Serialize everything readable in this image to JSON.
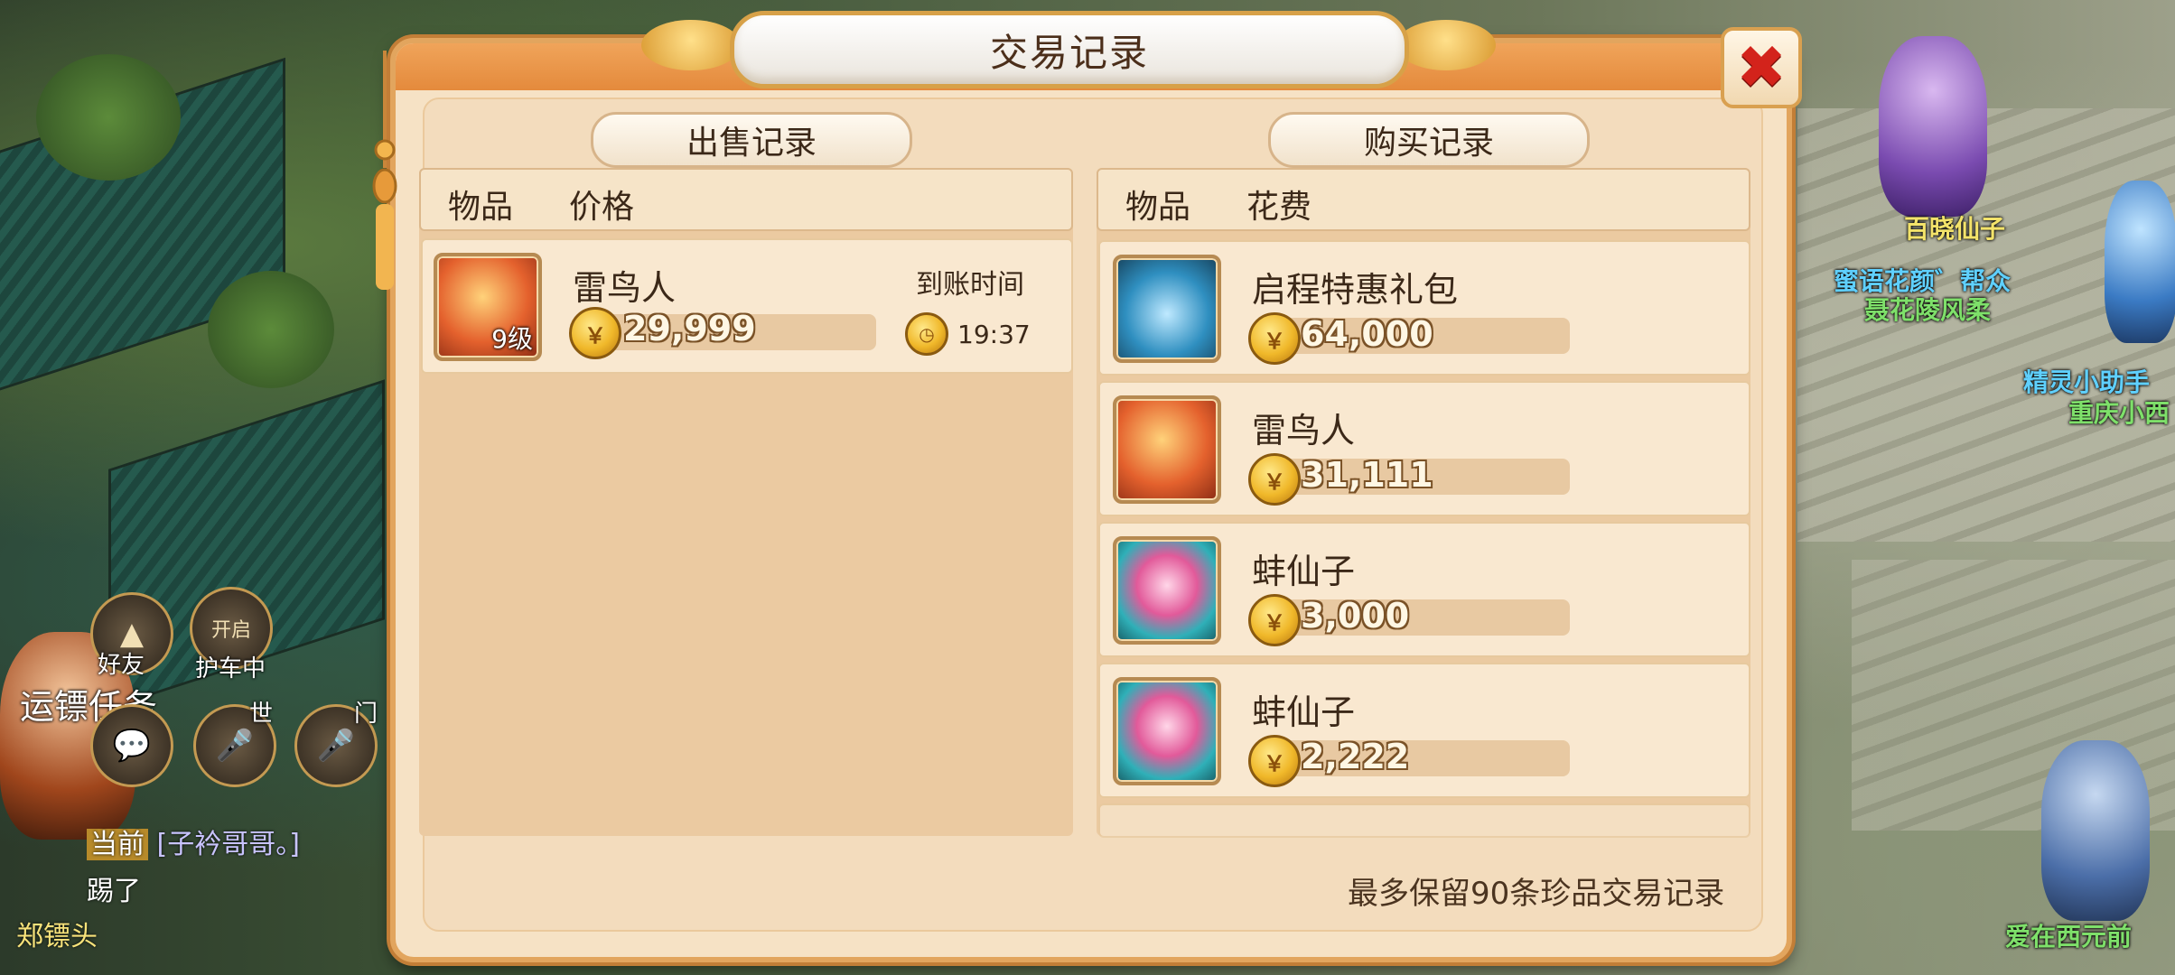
{
  "dialog": {
    "title": "交易记录",
    "close_symbol": "✖",
    "footer_note": "最多保留90条珍品交易记录"
  },
  "sell": {
    "tab_label": "出售记录",
    "col_item": "物品",
    "col_price": "价格",
    "arrival_label": "到账时间",
    "records": [
      {
        "name": "雷鸟人",
        "level": "9级",
        "price": "29,999",
        "time": "19:37",
        "icon": "thunderbird-icon"
      }
    ]
  },
  "buy": {
    "tab_label": "购买记录",
    "col_item": "物品",
    "col_cost": "花费",
    "records": [
      {
        "name": "启程特惠礼包",
        "price": "64,000",
        "icon": "treasure-chest-icon"
      },
      {
        "name": "雷鸟人",
        "price": "31,111",
        "icon": "thunderbird-icon"
      },
      {
        "name": "蚌仙子",
        "price": "3,000",
        "icon": "clam-fairy-icon"
      },
      {
        "name": "蚌仙子",
        "price": "2,222",
        "icon": "clam-fairy-icon"
      }
    ]
  },
  "hud": {
    "friend_label": "好友",
    "escort_label": "护车中",
    "escort_badge": "开启",
    "quest_label": "运镖任务",
    "world_tag": "世",
    "team_tag": "门",
    "chat": [
      {
        "channel": "当前",
        "text": "[子衿哥哥。]"
      },
      {
        "channel": "",
        "text": "踢了"
      },
      {
        "channel": "",
        "text": "郑镖头"
      }
    ]
  },
  "world": {
    "npc_names": [
      {
        "text": "百晓仙子",
        "color": "#f3e36a"
      },
      {
        "text": "蜜语花颜゛帮众",
        "color": "#5fd0ff"
      },
      {
        "text": "聂花陵风柔",
        "color": "#7ee06a"
      },
      {
        "text": "精灵小助手",
        "color": "#5fd0ff"
      },
      {
        "text": "重庆小西",
        "color": "#7ee06a"
      },
      {
        "text": "爱在西元前",
        "color": "#7ee06a"
      }
    ]
  },
  "colors": {
    "dialog_bg": "#f6e2c5",
    "frame_orange": "#e48a3c",
    "close_red": "#d3231b"
  }
}
